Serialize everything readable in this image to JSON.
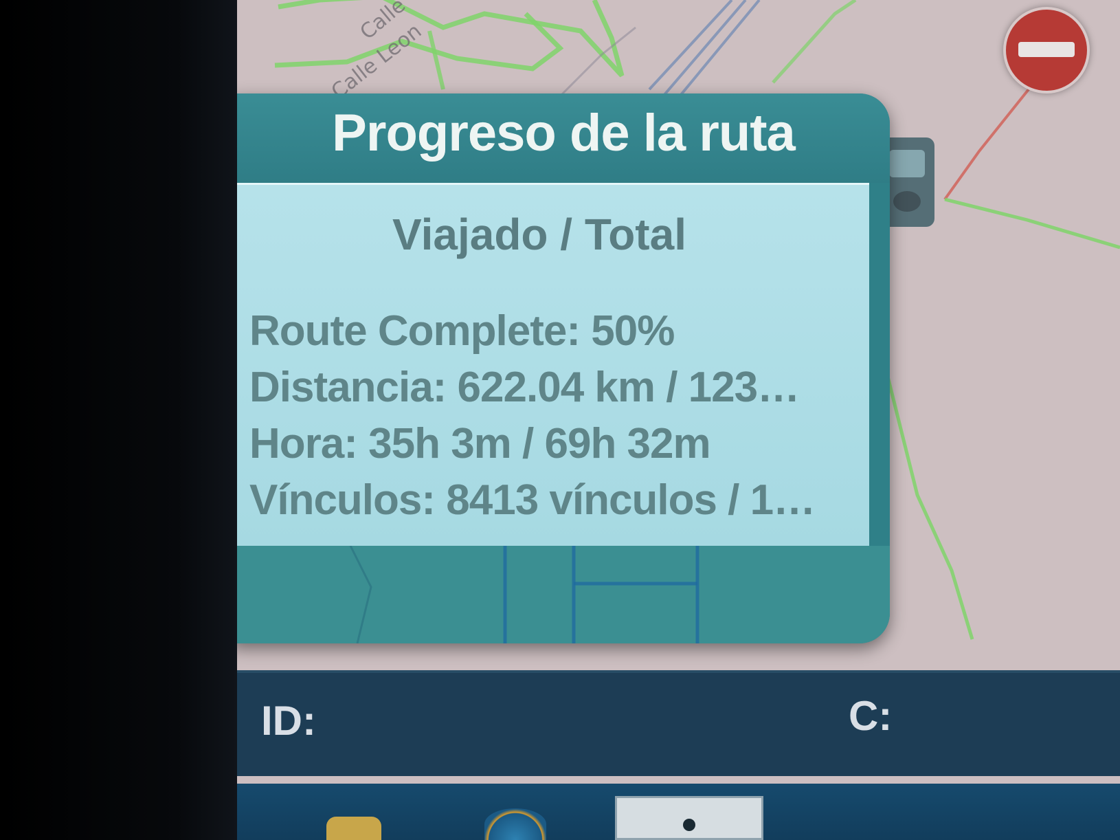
{
  "dialog": {
    "title": "Progreso de la ruta",
    "subheading": "Viajado / Total",
    "lines": [
      "Route Complete: 50%",
      "Distancia: 622.04 km / 123…",
      "Hora: 35h 3m / 69h 32m",
      "Vínculos: 8413 vínculos / 1…"
    ]
  },
  "status_bar": {
    "id_label": "ID:",
    "c_label": "C:"
  },
  "map": {
    "street_labels": [
      "Calle",
      "Calle Leon"
    ]
  },
  "icons": {
    "no_entry": "no-entry-icon",
    "vehicle": "vehicle-icon"
  },
  "colors": {
    "dialog_header": "#2f7d86",
    "dialog_body": "#b6e2ea",
    "status_bar": "#1d3d55",
    "map_background": "#cdbfc1",
    "route_green": "#7fd36a"
  }
}
